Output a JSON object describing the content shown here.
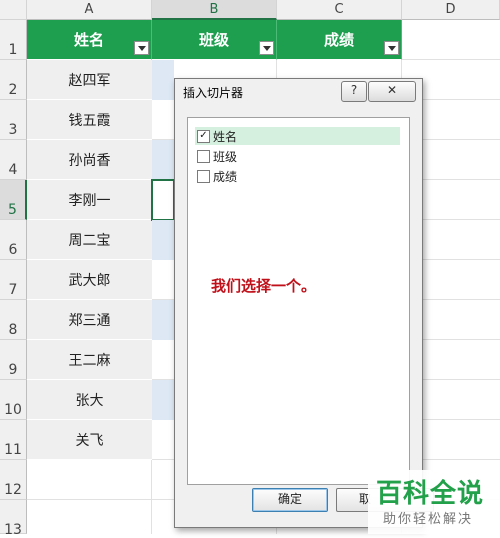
{
  "sheet": {
    "columns": [
      "A",
      "B",
      "C",
      "D"
    ],
    "rows": [
      "1",
      "2",
      "3",
      "4",
      "5",
      "6",
      "7",
      "8",
      "9",
      "10",
      "11",
      "12",
      "13"
    ],
    "headers": [
      "姓名",
      "班级",
      "成绩"
    ],
    "names": [
      "赵四军",
      "钱五霞",
      "孙尚香",
      "李刚一",
      "周二宝",
      "武大郎",
      "郑三通",
      "王二麻",
      "张大",
      "关飞"
    ]
  },
  "dialog": {
    "title": "插入切片器",
    "help_label": "?",
    "close_label": "✕",
    "fields": [
      {
        "label": "姓名",
        "checked": true
      },
      {
        "label": "班级",
        "checked": false
      },
      {
        "label": "成绩",
        "checked": false
      }
    ],
    "check_mark": "✓",
    "note": "我们选择一个。",
    "ok_label": "确定",
    "cancel_label": "取"
  },
  "watermark": {
    "title": "百科全说",
    "subtitle": "助你轻松解决"
  },
  "colors": {
    "header_green": "#1e9e4f",
    "selection_green": "#217346",
    "note_red": "#c0101a"
  }
}
